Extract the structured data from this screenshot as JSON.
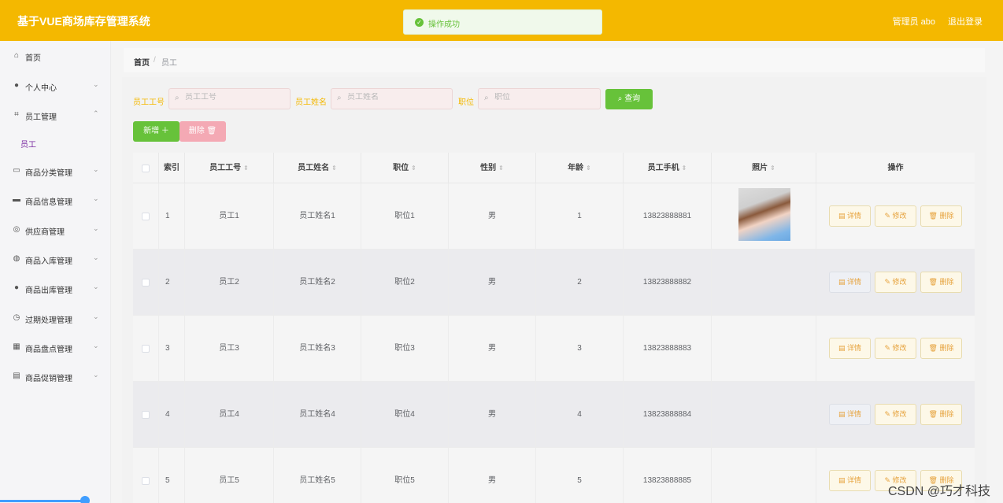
{
  "header": {
    "title": "基于VUE商场库存管理系统",
    "user": "管理员 abo",
    "logout": "退出登录"
  },
  "toast": {
    "icon": "check-circle-icon",
    "message": "操作成功"
  },
  "sidebar": {
    "items": [
      {
        "label": "首页",
        "icon": "home-icon"
      },
      {
        "label": "个人中心",
        "icon": "user-icon"
      },
      {
        "label": "员工管理",
        "icon": "crop-icon"
      },
      {
        "label": "员工",
        "sub": true
      },
      {
        "label": "商品分类管理",
        "icon": "category-icon"
      },
      {
        "label": "商品信息管理",
        "icon": "briefcase-icon"
      },
      {
        "label": "供应商管理",
        "icon": "compass-icon"
      },
      {
        "label": "商品入库管理",
        "icon": "globe-icon"
      },
      {
        "label": "商品出库管理",
        "icon": "person-icon"
      },
      {
        "label": "过期处理管理",
        "icon": "clock-icon"
      },
      {
        "label": "商品盘点管理",
        "icon": "grid-icon"
      },
      {
        "label": "商品促销管理",
        "icon": "clipboard-icon"
      }
    ]
  },
  "breadcrumb": {
    "home": "首页",
    "sep": "/",
    "current": "员工"
  },
  "filters": {
    "f1": {
      "label": "员工工号",
      "placeholder": "员工工号"
    },
    "f2": {
      "label": "员工姓名",
      "placeholder": "员工姓名"
    },
    "f3": {
      "label": "职位",
      "placeholder": "职位"
    },
    "query": "查询"
  },
  "actions": {
    "add": "新增 ＋",
    "delete": "删除 🗑"
  },
  "table": {
    "headers": [
      "索引",
      "员工工号",
      "员工姓名",
      "职位",
      "性别",
      "年龄",
      "员工手机",
      "照片",
      "操作"
    ],
    "rows": [
      {
        "index": "1",
        "no": "员工1",
        "name": "员工姓名1",
        "pos": "职位1",
        "sex": "男",
        "age": "1",
        "phone": "13823888881",
        "photo": true
      },
      {
        "index": "2",
        "no": "员工2",
        "name": "员工姓名2",
        "pos": "职位2",
        "sex": "男",
        "age": "2",
        "phone": "13823888882",
        "photo": false
      },
      {
        "index": "3",
        "no": "员工3",
        "name": "员工姓名3",
        "pos": "职位3",
        "sex": "男",
        "age": "3",
        "phone": "13823888883",
        "photo": false
      },
      {
        "index": "4",
        "no": "员工4",
        "name": "员工姓名4",
        "pos": "职位4",
        "sex": "男",
        "age": "4",
        "phone": "13823888884",
        "photo": false
      },
      {
        "index": "5",
        "no": "员工5",
        "name": "员工姓名5",
        "pos": "职位5",
        "sex": "男",
        "age": "5",
        "phone": "13823888885",
        "photo": false
      }
    ],
    "ops": {
      "detail": "详情",
      "edit": "修改",
      "del": "删除"
    }
  },
  "watermark": "CSDN @巧才科技"
}
